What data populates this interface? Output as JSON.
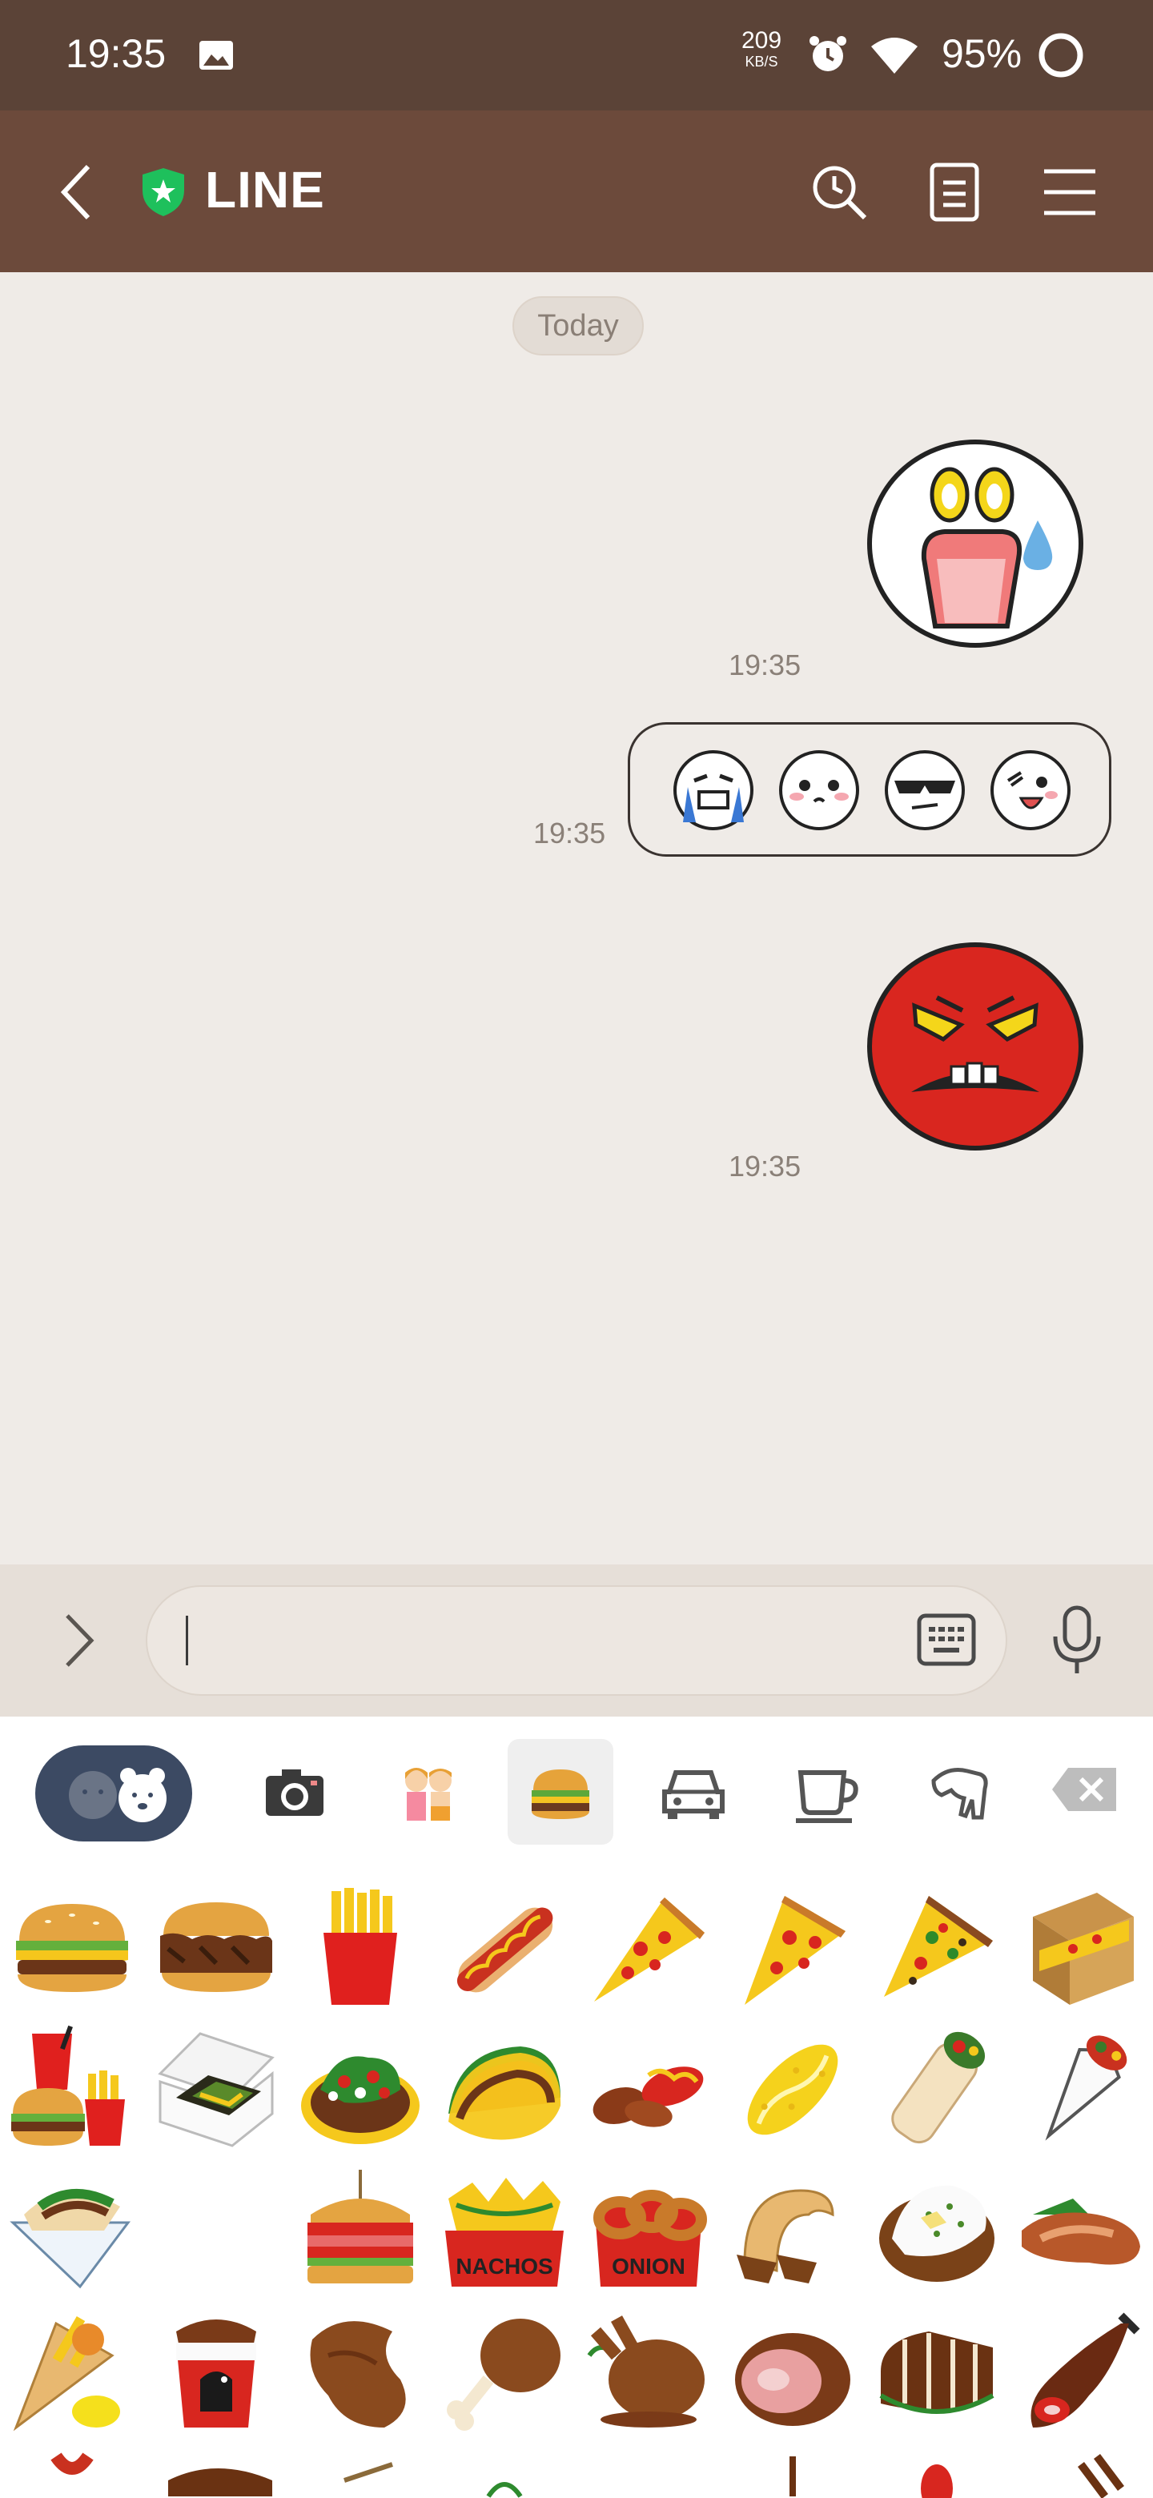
{
  "status_bar": {
    "time": "19:35",
    "speed_value": "209",
    "speed_unit": "KB/S",
    "battery": "95%"
  },
  "header": {
    "title": "LINE"
  },
  "chat": {
    "date_chip": "Today",
    "messages": [
      {
        "type": "sticker",
        "sticker": "shocked-face",
        "time": "19:35"
      },
      {
        "type": "emoji-bubble",
        "emojis": [
          "crying-face",
          "blushing-face",
          "sunglasses-face",
          "winking-face"
        ],
        "time": "19:35"
      },
      {
        "type": "sticker",
        "sticker": "angry-red-face",
        "time": "19:35"
      }
    ]
  },
  "input": {
    "value": "",
    "placeholder": ""
  },
  "emoji_keyboard": {
    "tabs": [
      "smileys-animals",
      "camera",
      "people",
      "food",
      "car",
      "coffee-cup",
      "hand-gesture",
      "backspace"
    ],
    "selected_tab": "food",
    "food_items": [
      [
        "hamburger",
        "double-burger",
        "french-fries",
        "hot-dog",
        "pizza-slice",
        "pizza-slice-2",
        "pizza-slice-veggie",
        "pizza-box"
      ],
      [
        "burger-meal",
        "takeout-box",
        "salad-plate",
        "taco",
        "sausages",
        "corn-dog",
        "burrito",
        "wrap"
      ],
      [
        "taco-wrap",
        "",
        "club-sandwich",
        "nachos",
        "onion-rings",
        "churros",
        "baked-potato",
        "hot-pocket"
      ],
      [
        "fries-cone",
        "chicken-bucket",
        "chicken-wing",
        "drumstick",
        "roast-chicken",
        "ham",
        "meatloaf",
        "jamon"
      ]
    ],
    "labels": {
      "nachos": "NACHOS",
      "onion": "ONION"
    }
  },
  "colors": {
    "header_bg": "#6c4a3b",
    "status_bg": "#5b4337",
    "chat_bg": "#efebe7",
    "accent_green": "#1ec05c"
  }
}
